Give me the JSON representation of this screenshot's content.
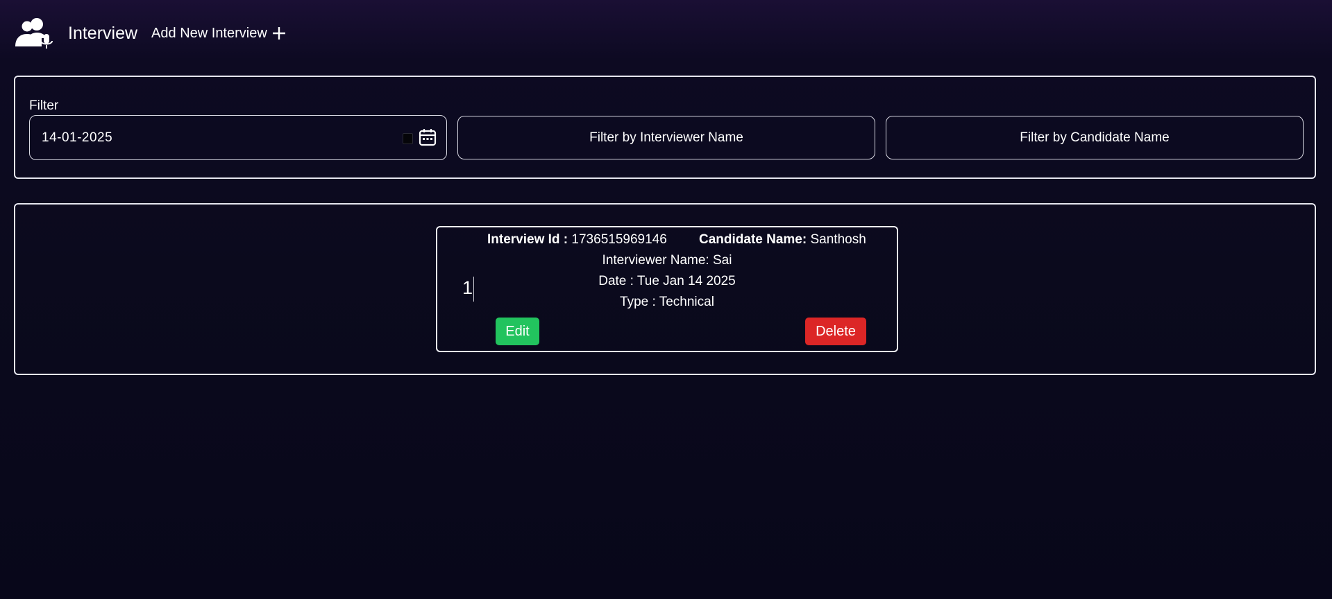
{
  "header": {
    "logo_icon": "interview-users-mic-icon",
    "title": "Interview",
    "add_label": "Add New Interview",
    "add_icon": "plus-icon"
  },
  "filter": {
    "label": "Filter",
    "date_value": "14-01-2025",
    "date_icon": "calendar-icon",
    "interviewer_placeholder": "Filter by Interviewer Name",
    "candidate_placeholder": "Filter by Candidate Name"
  },
  "interviews": [
    {
      "index": "1",
      "id_label": "Interview Id :",
      "id_value": "1736515969146",
      "candidate_label": "Candidate Name:",
      "candidate_value": "Santhosh",
      "interviewer_text": "Interviewer Name: Sai",
      "date_text": "Date : Tue Jan 14 2025",
      "type_text": "Type : Technical",
      "edit_label": "Edit",
      "delete_label": "Delete"
    }
  ],
  "colors": {
    "background": "#0b0a1d",
    "edit_button": "#22c35e",
    "delete_button": "#dc2626",
    "border": "#e6e6ef"
  }
}
